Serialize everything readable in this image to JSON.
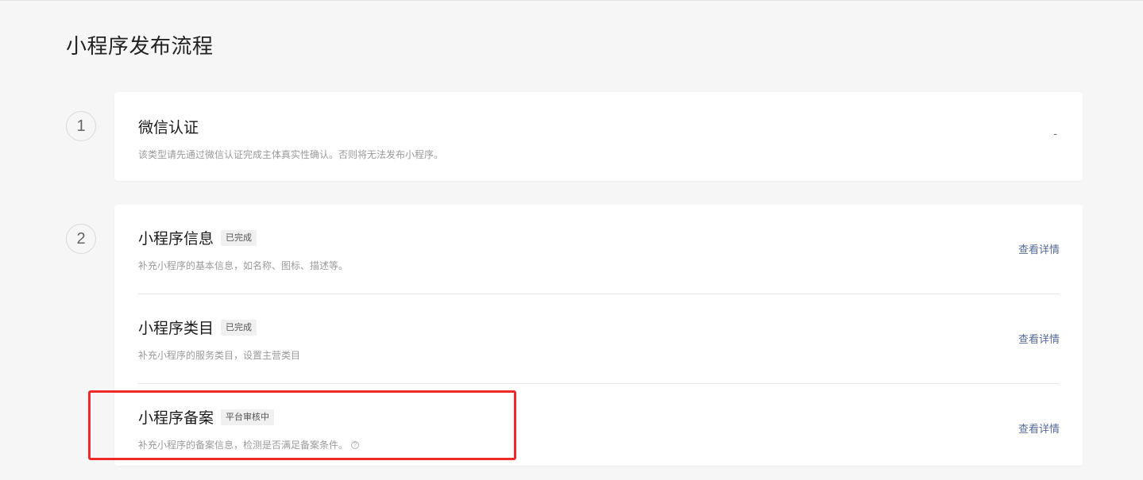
{
  "page": {
    "title": "小程序发布流程"
  },
  "steps": [
    {
      "number": "1",
      "items": [
        {
          "title": "微信认证",
          "desc": "该类型请先通过微信认证完成主体真实性确认。否则将无法发布小程序。",
          "action": "-"
        }
      ]
    },
    {
      "number": "2",
      "items": [
        {
          "title": "小程序信息",
          "badge": "已完成",
          "desc": "补充小程序的基本信息，如名称、图标、描述等。",
          "action": "查看详情"
        },
        {
          "title": "小程序类目",
          "badge": "已完成",
          "desc": "补充小程序的服务类目，设置主营类目",
          "action": "查看详情"
        },
        {
          "title": "小程序备案",
          "badge": "平台审核中",
          "desc": "补充小程序的备案信息，检测是否满足备案条件。",
          "action": "查看详情"
        }
      ]
    }
  ],
  "icons": {
    "help": "?"
  },
  "colors": {
    "link": "#576b95",
    "highlight": "#f02a2a"
  }
}
